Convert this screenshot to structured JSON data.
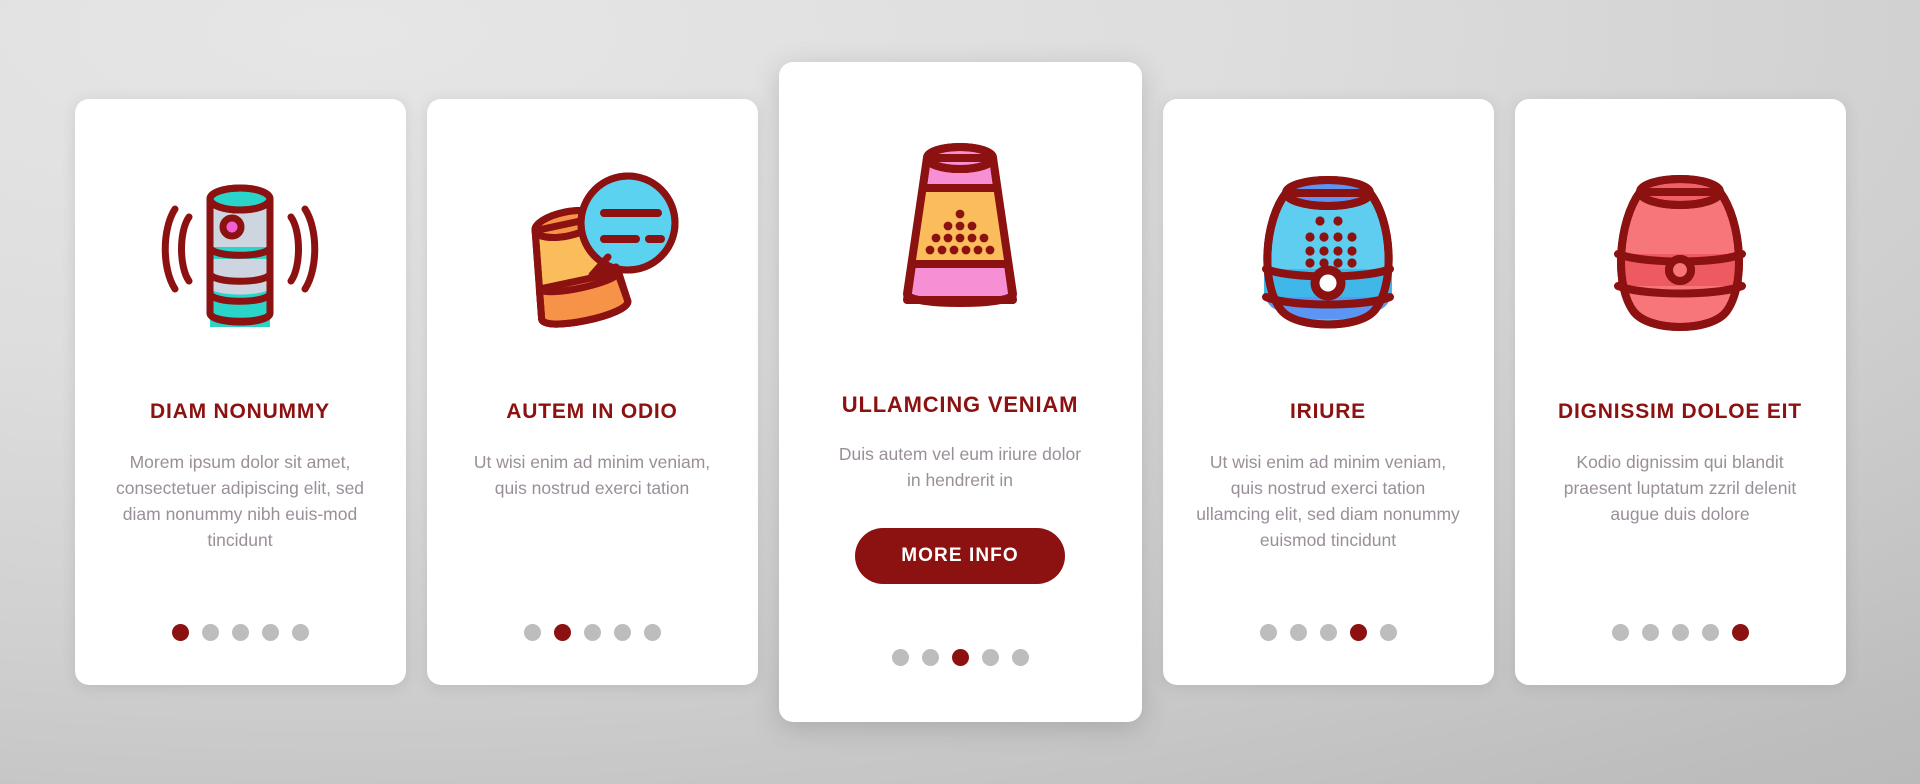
{
  "theme": {
    "background_light": "#e6e6e6",
    "background_dark": "#b4b4b4",
    "card_background": "#ffffff",
    "accent": "#8c1111",
    "title_color": "#8c1111",
    "body_text_color": "#9a8f99",
    "dot_inactive": "#bdbdbd",
    "dot_active": "#8c1111"
  },
  "cards": [
    {
      "id": "card-1",
      "icon_name": "smart-speaker-cylinder-sound-waves-icon",
      "title": "DIAM NONUMMY",
      "body": "Morem ipsum dolor sit amet, consectetuer adipiscing elit, sed diam nonummy nibh euis-mod tincidunt",
      "featured": false,
      "button": null,
      "dots": {
        "count": 5,
        "active_index": 0
      }
    },
    {
      "id": "card-2",
      "icon_name": "smart-speaker-speech-bubble-icon",
      "title": "AUTEM IN ODIO",
      "body": "Ut wisi enim ad minim veniam, quis nostrud exerci tation",
      "featured": false,
      "button": null,
      "dots": {
        "count": 5,
        "active_index": 1
      }
    },
    {
      "id": "card-3",
      "icon_name": "smart-speaker-tapered-grill-icon",
      "title": "ULLAMCING VENIAM",
      "body": "Duis autem vel eum iriure dolor in hendrerit in",
      "featured": true,
      "button": {
        "label": "MORE INFO"
      },
      "dots": {
        "count": 5,
        "active_index": 2
      }
    },
    {
      "id": "card-4",
      "icon_name": "smart-speaker-barrel-dots-button-icon",
      "title": "IRIURE",
      "body": "Ut wisi enim ad minim veniam, quis nostrud exerci tation ullamcing elit, sed diam nonummy euismod tincidunt",
      "featured": false,
      "button": null,
      "dots": {
        "count": 5,
        "active_index": 3
      }
    },
    {
      "id": "card-5",
      "icon_name": "smart-speaker-barrel-red-icon",
      "title": "DIGNISSIM DOLOE EIT",
      "body": "Kodio dignissim qui blandit praesent luptatum zzril delenit augue duis dolore",
      "featured": false,
      "button": null,
      "dots": {
        "count": 5,
        "active_index": 4
      }
    }
  ]
}
